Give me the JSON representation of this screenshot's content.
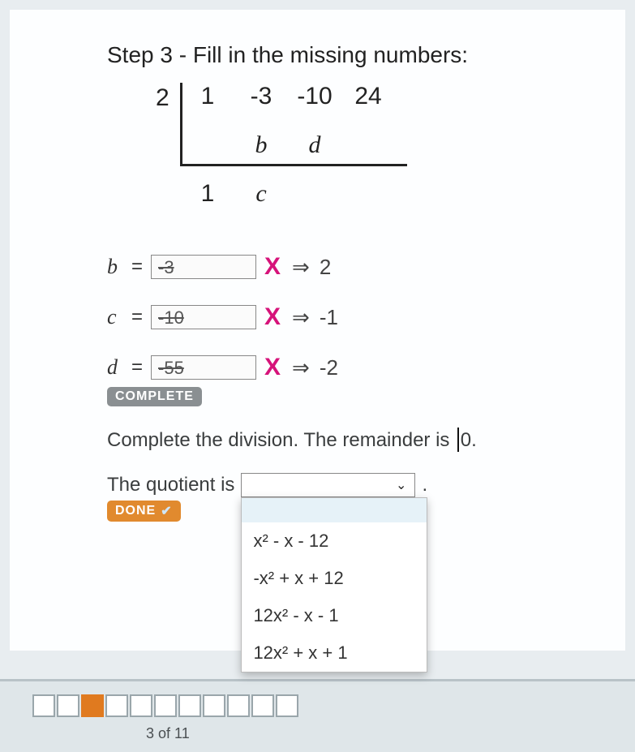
{
  "step_title": "Step 3 - Fill in the missing numbers:",
  "synthetic": {
    "divisor": "2",
    "row1": [
      "1",
      "-3",
      "-10",
      "24"
    ],
    "row2": [
      "",
      "b",
      "d",
      ""
    ],
    "row3": [
      "1",
      "c",
      "",
      ""
    ]
  },
  "answers": {
    "b": {
      "var": "b",
      "entered": "-3",
      "correct": "2"
    },
    "c": {
      "var": "c",
      "entered": "-10",
      "correct": "-1"
    },
    "d": {
      "var": "d",
      "entered": "-55",
      "correct": "-2"
    }
  },
  "complete_label": "COMPLETE",
  "remainder_sentence_pre": "Complete the division. The remainder is",
  "remainder_value": "0",
  "remainder_sentence_post": ".",
  "quotient_label": "The quotient is",
  "done_label": "DONE",
  "dropdown_options": [
    "x² - x - 12",
    "-x² + x + 12",
    "12x² - x - 1",
    "12x² + x + 1"
  ],
  "pager": {
    "current": 3,
    "total": 11,
    "text": "3 of 11"
  }
}
